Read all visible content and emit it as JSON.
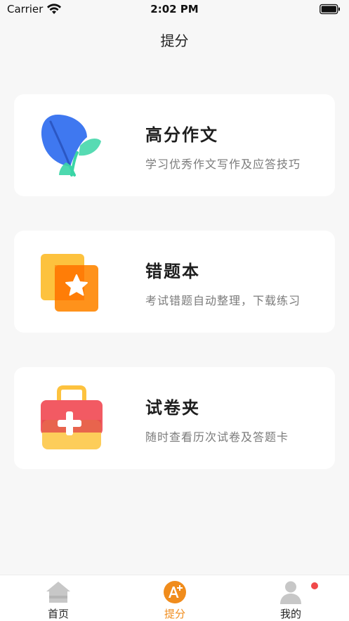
{
  "status_bar": {
    "carrier": "Carrier",
    "time": "2:02 PM",
    "icons": [
      "wifi-icon",
      "battery-icon"
    ]
  },
  "nav": {
    "title": "提分"
  },
  "cards": [
    {
      "title": "高分作文",
      "subtitle": "学习优秀作文写作及应答技巧",
      "icon": "leaf-icon"
    },
    {
      "title": "错题本",
      "subtitle": "考试错题自动整理，下载练习",
      "icon": "star-note-icon"
    },
    {
      "title": "试卷夹",
      "subtitle": "随时查看历次试卷及答题卡",
      "icon": "toolbox-icon"
    }
  ],
  "tabs": [
    {
      "label": "首页",
      "icon": "home-icon",
      "active": false
    },
    {
      "label": "提分",
      "icon": "grade-a-plus-icon",
      "active": true
    },
    {
      "label": "我的",
      "icon": "user-icon",
      "active": false,
      "badge": true
    }
  ],
  "colors": {
    "accent": "#f08c1c",
    "badge": "#f0494a",
    "icon_inactive": "#c7c7c7"
  }
}
